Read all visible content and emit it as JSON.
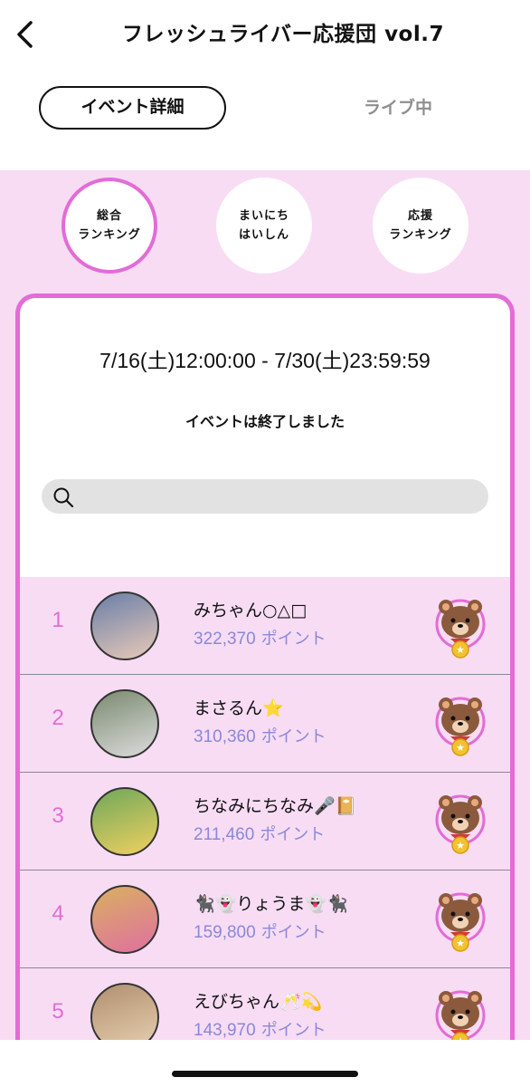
{
  "header": {
    "title": "フレッシュライバー応援団 vol.7",
    "back_icon": "chevron-left-icon"
  },
  "tabs": {
    "detail": "イベント詳細",
    "live": "ライブ中"
  },
  "ranking_tabs": [
    {
      "line1": "総合",
      "line2": "ランキング",
      "active": true
    },
    {
      "line1": "まいにち",
      "line2": "はいしん",
      "active": false
    },
    {
      "line1": "応援",
      "line2": "ランキング",
      "active": false
    }
  ],
  "event": {
    "period": "7/16(土)12:00:00 - 7/30(土)23:59:59",
    "status": "イベントは終了しました"
  },
  "search": {
    "placeholder": "",
    "icon": "search-icon"
  },
  "points_unit": "ポイント",
  "ranking": [
    {
      "rank": "1",
      "name": "みちゃん○△□",
      "points": "322,370",
      "avatar_colors": [
        "#6a7fa8",
        "#e8c9b8"
      ]
    },
    {
      "rank": "2",
      "name": "まさるん⭐",
      "points": "310,360",
      "avatar_colors": [
        "#7a8a70",
        "#dcdcdc"
      ]
    },
    {
      "rank": "3",
      "name": "ちなみにちなみ🎤📔",
      "points": "211,460",
      "avatar_colors": [
        "#6fa85a",
        "#f0d060"
      ]
    },
    {
      "rank": "4",
      "name": "🐈‍⬛👻りょうま👻🐈‍⬛",
      "points": "159,800",
      "avatar_colors": [
        "#d9b060",
        "#e070a0"
      ]
    },
    {
      "rank": "5",
      "name": "えびちゃん🥂💫",
      "points": "143,970",
      "avatar_colors": [
        "#b09070",
        "#e8d0b0"
      ]
    }
  ],
  "colors": {
    "accent": "#e36cd6",
    "panel_bg": "#f7dcf4",
    "points": "#8a88d8",
    "inactive_tab": "#8f8f8f"
  }
}
